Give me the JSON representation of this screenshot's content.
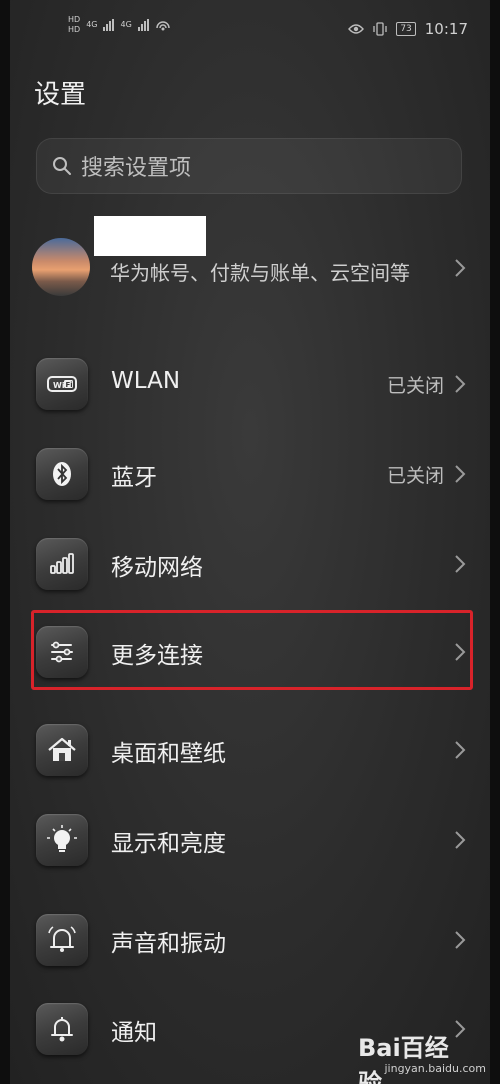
{
  "status_bar": {
    "left_tags": [
      "HD",
      "HD"
    ],
    "net_label": "4G",
    "battery": "73",
    "time": "10:17"
  },
  "page": {
    "title": "设置"
  },
  "search": {
    "placeholder": "搜索设置项"
  },
  "account": {
    "subtitle": "华为帐号、付款与账单、云空间等"
  },
  "rows": [
    {
      "label": "WLAN",
      "value": "已关闭",
      "icon": "wifi-icon"
    },
    {
      "label": "蓝牙",
      "value": "已关闭",
      "icon": "bluetooth-icon"
    },
    {
      "label": "移动网络",
      "value": "",
      "icon": "signal-bars-icon"
    },
    {
      "label": "更多连接",
      "value": "",
      "icon": "connections-icon",
      "highlighted": true
    },
    {
      "label": "桌面和壁纸",
      "value": "",
      "icon": "home-icon"
    },
    {
      "label": "显示和亮度",
      "value": "",
      "icon": "bulb-icon"
    },
    {
      "label": "声音和振动",
      "value": "",
      "icon": "bell-icon"
    },
    {
      "label": "通知",
      "value": "",
      "icon": "notification-icon"
    }
  ],
  "watermark": {
    "logo": "Bai百经验",
    "sub": "jingyan.baidu.com"
  },
  "colors": {
    "highlight": "#d8232a",
    "background": "#2c2c2c"
  }
}
